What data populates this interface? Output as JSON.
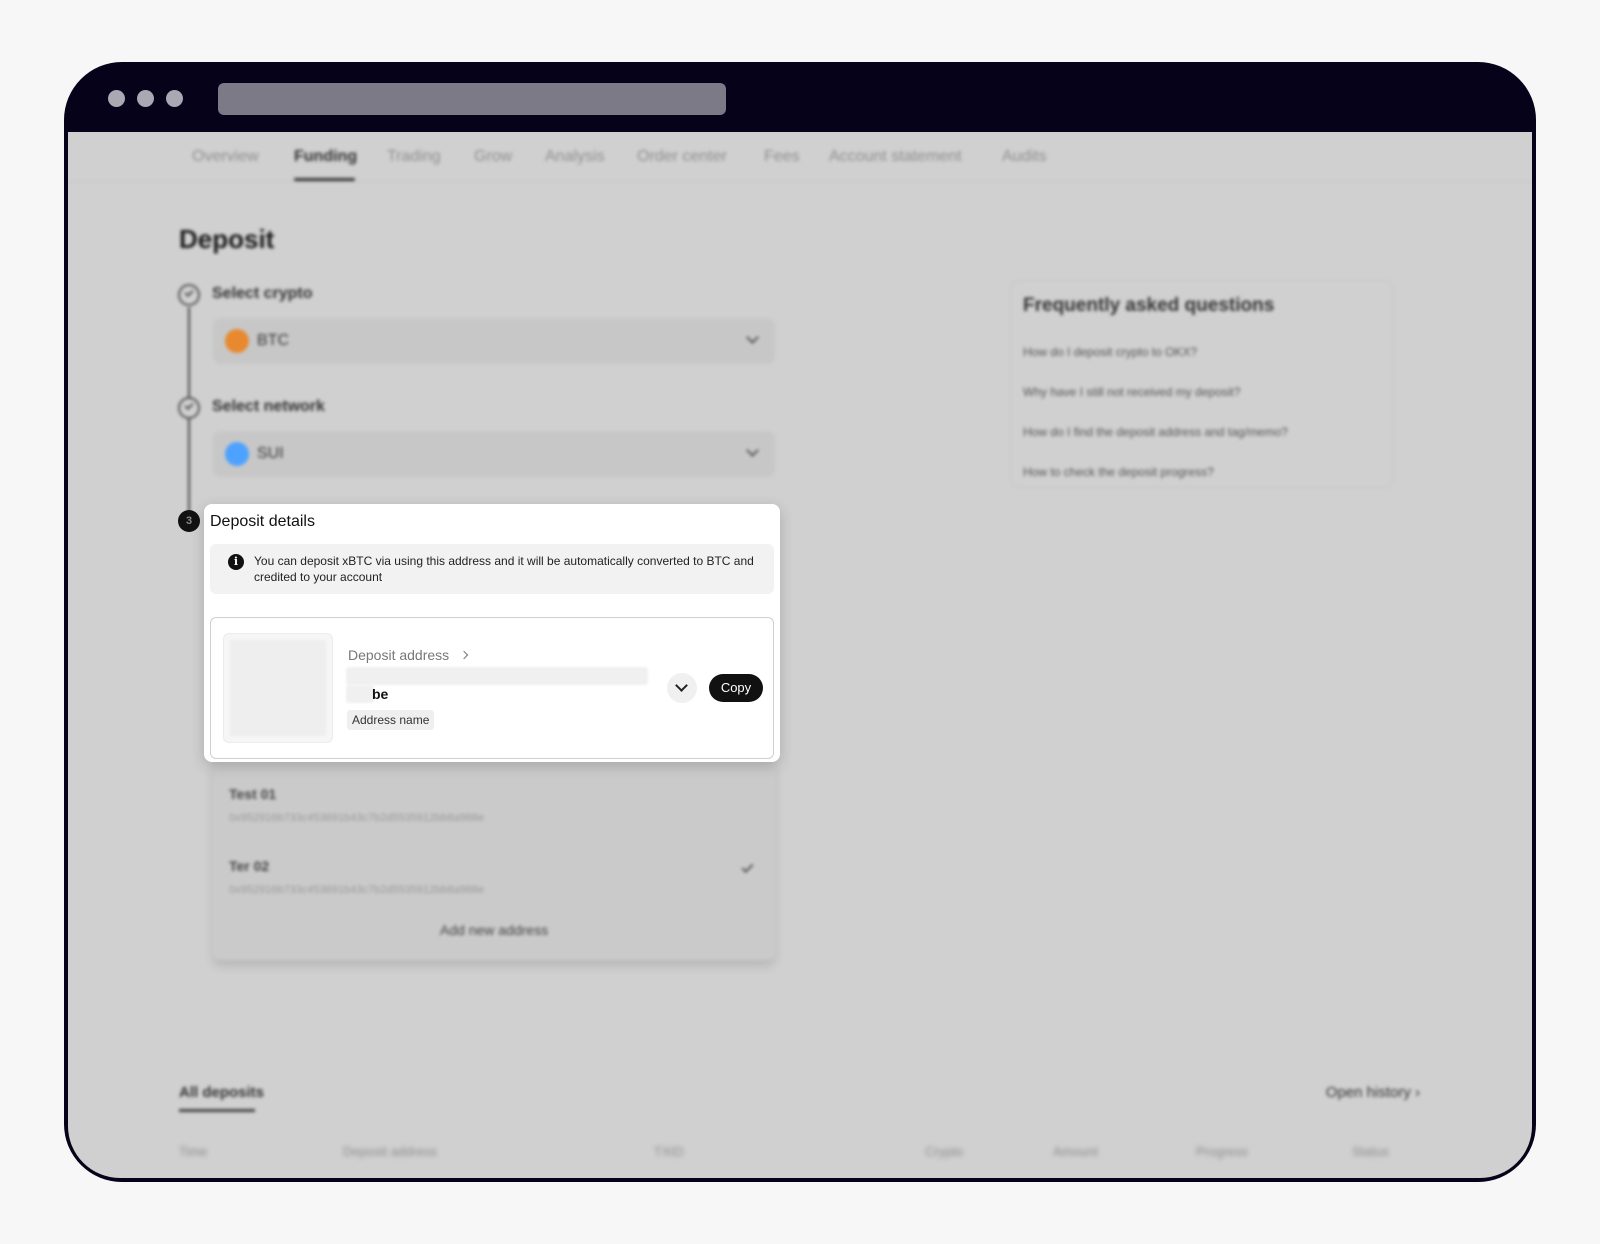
{
  "nav": {
    "tabs": [
      "Overview",
      "Funding",
      "Trading",
      "Grow",
      "Analysis",
      "Order center",
      "Fees",
      "Account statement",
      "Audits"
    ],
    "active": "Funding"
  },
  "page": {
    "title": "Deposit"
  },
  "steps": {
    "crypto": {
      "label": "Select crypto",
      "value": "BTC",
      "icon": "btc-coin-icon"
    },
    "network": {
      "label": "Select network",
      "value": "SUI",
      "icon": "sui-coin-icon"
    },
    "details": {
      "number": "3",
      "title": "Deposit details"
    }
  },
  "info": {
    "text": "You can deposit xBTC via using this address and it will be automatically converted to BTC and credited to your account"
  },
  "address_card": {
    "label": "Deposit address",
    "address_end": "be",
    "address_name": "Address name",
    "copy_label": "Copy"
  },
  "address_list": {
    "items": [
      {
        "name": "Test 01",
        "address": "0x952916b733c453691b43c7b2d5535912bb8a988e"
      },
      {
        "name": "Ter 02",
        "address": "0x952916b733c453691b43c7b2d5535912bb8a988e",
        "selected": true
      }
    ],
    "add_label": "Add new address"
  },
  "faq": {
    "title": "Frequently asked questions",
    "questions": [
      "How do I deposit crypto to OKX?",
      "Why have I still not received my deposit?",
      "How do I find the deposit address and tag/memo?",
      "How to check the deposit progress?"
    ]
  },
  "history": {
    "tab": "All deposits",
    "open_history": "Open history",
    "columns": [
      "Time",
      "Deposit address",
      "TXID",
      "Crypto",
      "Amount",
      "Progress",
      "Status"
    ]
  },
  "colors": {
    "btc": "#e8892f",
    "sui": "#4da2ff",
    "accent": "#111111"
  }
}
